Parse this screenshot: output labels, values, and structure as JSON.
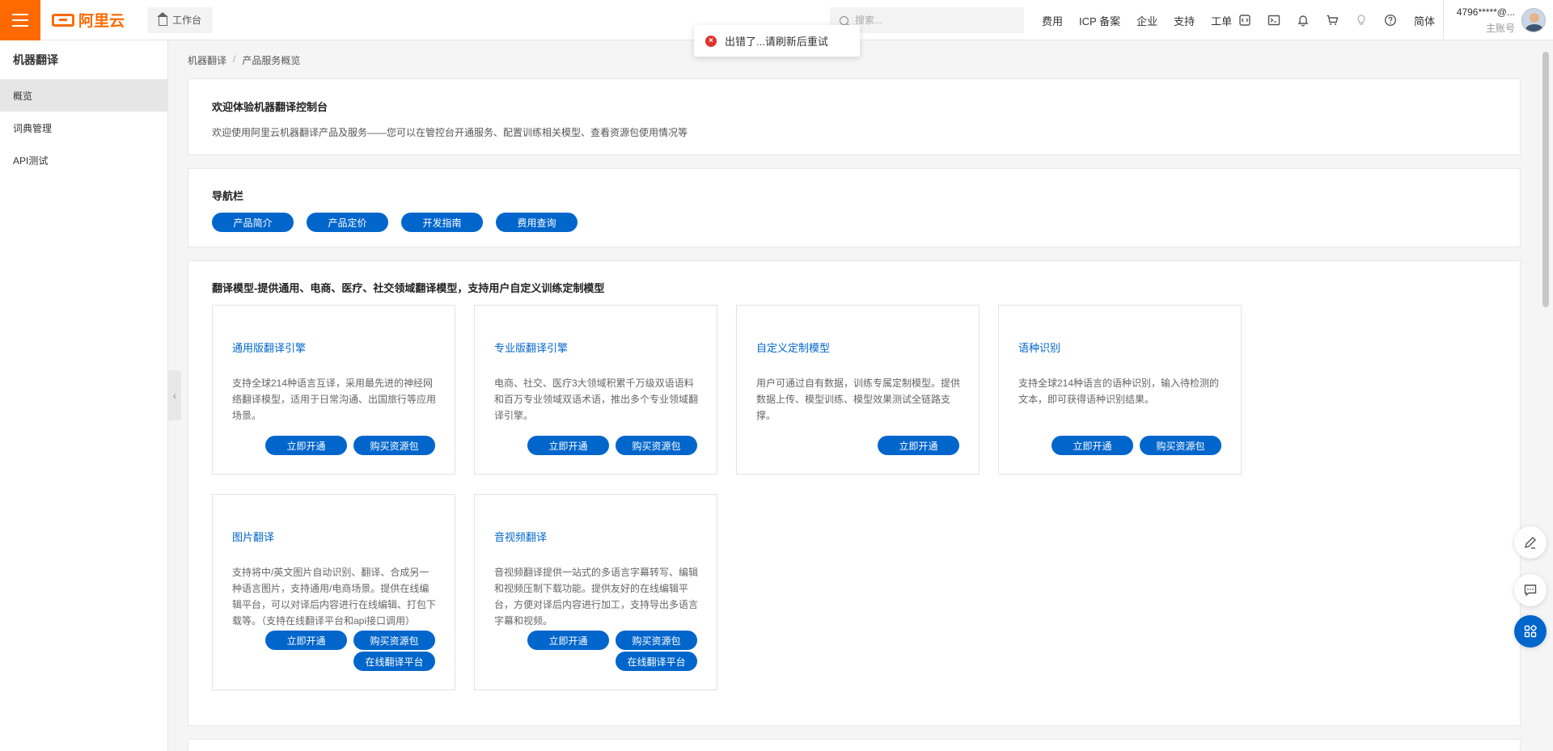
{
  "topbar": {
    "logo_text": "阿里云",
    "workbench": "工作台",
    "search_placeholder": "搜索...",
    "links": [
      "费用",
      "ICP 备案",
      "企业",
      "支持",
      "工单"
    ],
    "lang": "简体",
    "account_id": "4796*****@...",
    "account_role": "主账号"
  },
  "toast": {
    "message": "出错了...请刷新后重试"
  },
  "sidebar": {
    "title": "机器翻译",
    "items": [
      "概览",
      "词典管理",
      "API测试"
    ]
  },
  "breadcrumb": [
    "机器翻译",
    "产品服务概览"
  ],
  "welcome": {
    "title": "欢迎体验机器翻译控制台",
    "desc": "欢迎使用阿里云机器翻译产品及服务——您可以在管控台开通服务、配置训练相关模型、查看资源包使用情况等"
  },
  "navbar": {
    "title": "导航栏",
    "buttons": [
      "产品简介",
      "产品定价",
      "开发指南",
      "费用查询"
    ]
  },
  "models": {
    "title": "翻译模型-提供通用、电商、医疗、社交领域翻译模型，支持用户自定义训练定制模型",
    "cards": [
      {
        "title": "通用版翻译引擎",
        "desc": "支持全球214种语言互译，采用最先进的神经网络翻译模型，适用于日常沟通、出国旅行等应用场景。",
        "btn1": "立即开通",
        "btn2": "购买资源包"
      },
      {
        "title": "专业版翻译引擎",
        "desc": "电商、社交、医疗3大领域积累千万级双语语料和百万专业领域双语术语，推出多个专业领域翻译引擎。",
        "btn1": "立即开通",
        "btn2": "购买资源包"
      },
      {
        "title": "自定义定制模型",
        "desc": "用户可通过自有数据，训练专属定制模型。提供数据上传、模型训练、模型效果测试全链路支撑。",
        "btn1": "立即开通"
      },
      {
        "title": "语种识别",
        "desc": "支持全球214种语言的语种识别，输入待检测的文本，即可获得语种识别结果。",
        "btn1": "立即开通",
        "btn2": "购买资源包"
      },
      {
        "title": "图片翻译",
        "desc": "支持将中/英文图片自动识别、翻译、合成另一种语言图片，支持通用/电商场景。提供在线编辑平台，可以对译后内容进行在线编辑、打包下载等。（支持在线翻译平台和api接口调用）",
        "btn1": "立即开通",
        "btn2": "购买资源包",
        "btn3": "在线翻译平台"
      },
      {
        "title": "音视频翻译",
        "desc": "音视频翻译提供一站式的多语言字幕转写、编辑和视频压制下载功能。提供友好的在线编辑平台，方便对译后内容进行加工，支持导出多语言字幕和视频。",
        "btn1": "立即开通",
        "btn2": "购买资源包",
        "btn3": "在线翻译平台"
      }
    ]
  },
  "colors": {
    "accent": "#ff6a00",
    "primary": "#0066cc",
    "error": "#e0322a"
  }
}
